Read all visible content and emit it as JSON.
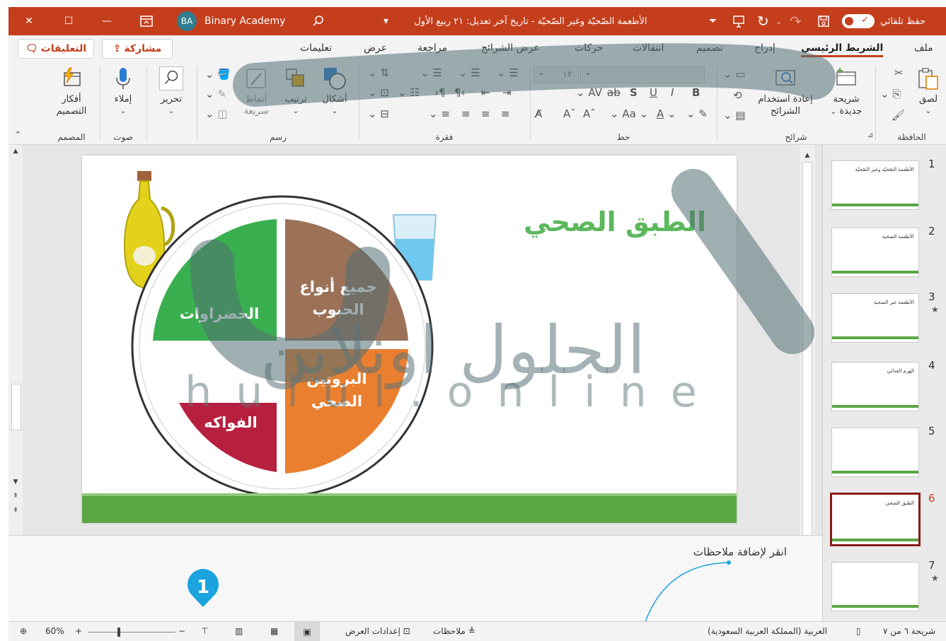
{
  "titlebar": {
    "autosave_label": "حفظ تلقائي",
    "doc_title": "الأطعمة الصّحيّة وغير الصّحيّة - تاريخ آخر تعديل: ٢١ ربيع الأول",
    "user_initials": "BA",
    "user_name": "Binary Academy",
    "icons": [
      "close-icon",
      "minimize-icon",
      "restore-icon",
      "ribbon-display-icon",
      "search-icon",
      "save-icon",
      "undo-icon",
      "redo-icon",
      "present-icon"
    ],
    "accent": "#c43e1c"
  },
  "tabs": {
    "file": "ملف",
    "home": "الشريط الرئيسي",
    "insert": "إدراج",
    "design": "تصميم",
    "transitions": "انتقالات",
    "animations": "حركات",
    "slideshow": "عرض الشرائح",
    "review": "مراجعة",
    "view": "عرض",
    "help": "تعليمات",
    "share": "مشاركة",
    "comments": "التعليقات"
  },
  "ribbon": {
    "clipboard": {
      "group": "الحافظة",
      "paste": "لصق"
    },
    "slides": {
      "group": "شرائح",
      "new_slide_1": "شريحة",
      "new_slide_2": "جديدة",
      "reuse_1": "إعادة استخدام",
      "reuse_2": "الشرائح"
    },
    "font": {
      "group": "خط",
      "size": "١٢",
      "bold": "B",
      "italic": "I",
      "underline": "U",
      "shadow": "S",
      "strike": "ab",
      "spacing": "AV",
      "case": "Aa"
    },
    "paragraph": {
      "group": "فقرة"
    },
    "drawing": {
      "group": "رسم",
      "shapes": "أشكال",
      "arrange": "ترتيب",
      "styles_1": "أنماط",
      "styles_2": "سريعة"
    },
    "editing": {
      "label": "تحرير"
    },
    "voice": {
      "group": "صوت",
      "dictate": "إملاء"
    },
    "designer": {
      "group": "المصمم",
      "ideas_1": "أفكار",
      "ideas_2": "التصميم"
    }
  },
  "slide": {
    "title": "الطبق الصحي",
    "segments": {
      "grains_1": "جميع أنواع",
      "grains_2": "الحبوب",
      "vegetables": "الخضراوات",
      "protein_1": "البروتين",
      "protein_2": "الصحي",
      "fruits": "الفواكه"
    },
    "colors": {
      "grains": "#9b7258",
      "vegetables": "#3aaf4f",
      "protein": "#ea7f2f",
      "fruits": "#b71f3f",
      "title": "#5cb85c",
      "band": "#5aa745"
    }
  },
  "watermark": {
    "arabic": "الحلول اونلاين",
    "latin": "hulul.online"
  },
  "notes": {
    "placeholder": "انقر لإضافة ملاحظات"
  },
  "thumbnails": {
    "items": [
      {
        "num": "1",
        "title": "الأطعمة الصّحيّة وغير الصّحيّة",
        "star": ""
      },
      {
        "num": "2",
        "title": "الأطعمة الصحية",
        "star": ""
      },
      {
        "num": "3",
        "title": "الأطعمة غير الصحية",
        "star": "★"
      },
      {
        "num": "4",
        "title": "الهرم الغذائي",
        "star": ""
      },
      {
        "num": "5",
        "title": "",
        "star": ""
      },
      {
        "num": "6",
        "title": "الطبق الصحي",
        "star": ""
      },
      {
        "num": "7",
        "title": "",
        "star": "★"
      }
    ],
    "selected": 6
  },
  "status": {
    "slide_counter": "شريحة ٦ من ٧",
    "language": "العربية (المملكة العربية السعودية)",
    "notes": "ملاحظات",
    "display_settings": "إعدادات العرض",
    "zoom": "60%",
    "zoom_level": 0.6
  },
  "callout": {
    "number": "1"
  }
}
